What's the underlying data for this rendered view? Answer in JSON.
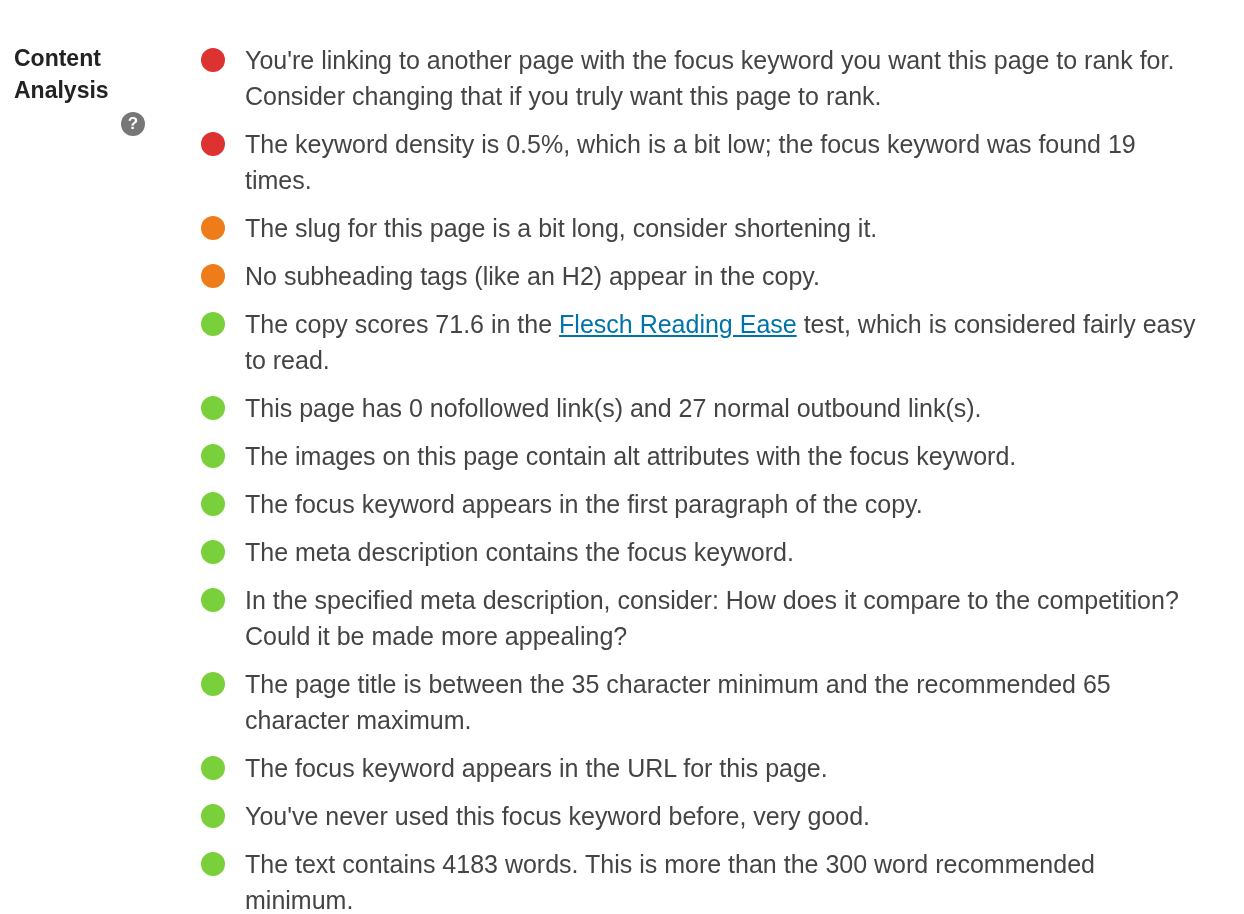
{
  "section": {
    "label": "Content Analysis",
    "help": "?"
  },
  "items": [
    {
      "color": "#dc3232",
      "text": "You're linking to another page with the focus keyword you want this page to rank for. Consider changing that if you truly want this page to rank."
    },
    {
      "color": "#dc3232",
      "text": "The keyword density is 0.5%, which is a bit low; the focus keyword was found 19 times."
    },
    {
      "color": "#ee7c1b",
      "text": "The slug for this page is a bit long, consider shortening it."
    },
    {
      "color": "#ee7c1b",
      "text": "No subheading tags (like an H2) appear in the copy."
    },
    {
      "color": "#7ad03a",
      "text": "The copy scores 71.6 in the ",
      "link": "Flesch Reading Ease",
      "text_after": " test, which is considered fairly easy to read."
    },
    {
      "color": "#7ad03a",
      "text": "This page has 0 nofollowed link(s) and 27 normal outbound link(s)."
    },
    {
      "color": "#7ad03a",
      "text": "The images on this page contain alt attributes with the focus keyword."
    },
    {
      "color": "#7ad03a",
      "text": "The focus keyword appears in the first paragraph of the copy."
    },
    {
      "color": "#7ad03a",
      "text": "The meta description contains the focus keyword."
    },
    {
      "color": "#7ad03a",
      "text": "In the specified meta description, consider: How does it compare to the competition? Could it be made more appealing?"
    },
    {
      "color": "#7ad03a",
      "text": "The page title is between the 35 character minimum and the recommended 65 character maximum."
    },
    {
      "color": "#7ad03a",
      "text": "The focus keyword appears in the URL for this page."
    },
    {
      "color": "#7ad03a",
      "text": "You've never used this focus keyword before, very good."
    },
    {
      "color": "#7ad03a",
      "text": "The text contains 4183 words. This is more than the 300 word recommended minimum."
    }
  ]
}
